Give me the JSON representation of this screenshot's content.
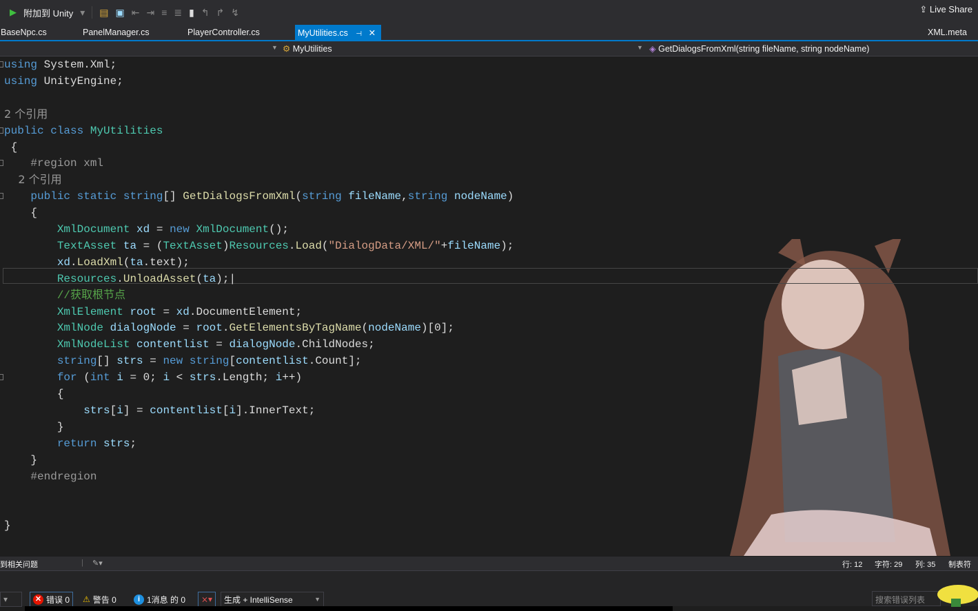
{
  "toolbar": {
    "attach_label": "附加到 Unity",
    "live_share": "Live Share"
  },
  "tabs": [
    {
      "label": "BaseNpc.cs"
    },
    {
      "label": "PanelManager.cs"
    },
    {
      "label": "PlayerController.cs"
    },
    {
      "label": "MyUtilities.cs",
      "active": true
    },
    {
      "label": "XML.meta"
    }
  ],
  "nav": {
    "class_name": "MyUtilities",
    "member": "GetDialogsFromXml(string fileName, string nodeName)"
  },
  "code": [
    [
      [
        "using",
        "kw"
      ],
      [
        " System.Xml;",
        "tx"
      ]
    ],
    [
      [
        "using",
        "kw"
      ],
      [
        " UnityEngine;",
        "tx"
      ]
    ],
    [],
    [
      [
        "2 个引用",
        "rf"
      ]
    ],
    [
      [
        "public",
        "kw"
      ],
      [
        " ",
        "tx"
      ],
      [
        "class",
        "kw"
      ],
      [
        " ",
        "tx"
      ],
      [
        "MyUtilities",
        "ty"
      ]
    ],
    [
      [
        " {",
        "tx"
      ]
    ],
    [
      [
        "    #region xml",
        "pp"
      ]
    ],
    [
      [
        "    2 个引用",
        "rf"
      ]
    ],
    [
      [
        "    ",
        "tx"
      ],
      [
        "public",
        "kw"
      ],
      [
        " ",
        "tx"
      ],
      [
        "static",
        "kw"
      ],
      [
        " ",
        "tx"
      ],
      [
        "string",
        "kw"
      ],
      [
        "[] ",
        "tx"
      ],
      [
        "GetDialogsFromXml",
        "fn"
      ],
      [
        "(",
        "tx"
      ],
      [
        "string",
        "kw"
      ],
      [
        " ",
        "tx"
      ],
      [
        "fileName",
        "pa"
      ],
      [
        ",",
        "tx"
      ],
      [
        "string",
        "kw"
      ],
      [
        " ",
        "tx"
      ],
      [
        "nodeName",
        "pa"
      ],
      [
        ")",
        "tx"
      ]
    ],
    [
      [
        "    {",
        "tx"
      ]
    ],
    [
      [
        "        ",
        "tx"
      ],
      [
        "XmlDocument",
        "ty"
      ],
      [
        " ",
        "tx"
      ],
      [
        "xd",
        "pa"
      ],
      [
        " = ",
        "tx"
      ],
      [
        "new",
        "kw"
      ],
      [
        " ",
        "tx"
      ],
      [
        "XmlDocument",
        "ty"
      ],
      [
        "();",
        "tx"
      ]
    ],
    [
      [
        "        ",
        "tx"
      ],
      [
        "TextAsset",
        "ty"
      ],
      [
        " ",
        "tx"
      ],
      [
        "ta",
        "pa"
      ],
      [
        " = (",
        "tx"
      ],
      [
        "TextAsset",
        "ty"
      ],
      [
        ")",
        "tx"
      ],
      [
        "Resources",
        "ty"
      ],
      [
        ".",
        "tx"
      ],
      [
        "Load",
        "fn"
      ],
      [
        "(",
        "tx"
      ],
      [
        "\"DialogData/XML/\"",
        "st"
      ],
      [
        "+",
        "tx"
      ],
      [
        "fileName",
        "pa"
      ],
      [
        ");",
        "tx"
      ]
    ],
    [
      [
        "        ",
        "tx"
      ],
      [
        "xd",
        "pa"
      ],
      [
        ".",
        "tx"
      ],
      [
        "LoadXml",
        "fn"
      ],
      [
        "(",
        "tx"
      ],
      [
        "ta",
        "pa"
      ],
      [
        ".text);",
        "tx"
      ]
    ],
    [
      [
        "        ",
        "tx"
      ],
      [
        "Resources",
        "ty"
      ],
      [
        ".",
        "tx"
      ],
      [
        "UnloadAsset",
        "fn"
      ],
      [
        "(",
        "tx"
      ],
      [
        "ta",
        "pa"
      ],
      [
        ");|",
        "tx"
      ]
    ],
    [
      [
        "        //获取根节点",
        "cm"
      ]
    ],
    [
      [
        "        ",
        "tx"
      ],
      [
        "XmlElement",
        "ty"
      ],
      [
        " ",
        "tx"
      ],
      [
        "root",
        "pa"
      ],
      [
        " = ",
        "tx"
      ],
      [
        "xd",
        "pa"
      ],
      [
        ".DocumentElement;",
        "tx"
      ]
    ],
    [
      [
        "        ",
        "tx"
      ],
      [
        "XmlNode",
        "ty"
      ],
      [
        " ",
        "tx"
      ],
      [
        "dialogNode",
        "pa"
      ],
      [
        " = ",
        "tx"
      ],
      [
        "root",
        "pa"
      ],
      [
        ".",
        "tx"
      ],
      [
        "GetElementsByTagName",
        "fn"
      ],
      [
        "(",
        "tx"
      ],
      [
        "nodeName",
        "pa"
      ],
      [
        ")[0];",
        "tx"
      ]
    ],
    [
      [
        "        ",
        "tx"
      ],
      [
        "XmlNodeList",
        "ty"
      ],
      [
        " ",
        "tx"
      ],
      [
        "contentlist",
        "pa"
      ],
      [
        " = ",
        "tx"
      ],
      [
        "dialogNode",
        "pa"
      ],
      [
        ".ChildNodes;",
        "tx"
      ]
    ],
    [
      [
        "        ",
        "tx"
      ],
      [
        "string",
        "kw"
      ],
      [
        "[] ",
        "tx"
      ],
      [
        "strs",
        "pa"
      ],
      [
        " = ",
        "tx"
      ],
      [
        "new",
        "kw"
      ],
      [
        " ",
        "tx"
      ],
      [
        "string",
        "kw"
      ],
      [
        "[",
        "tx"
      ],
      [
        "contentlist",
        "pa"
      ],
      [
        ".Count];",
        "tx"
      ]
    ],
    [
      [
        "        ",
        "tx"
      ],
      [
        "for",
        "kw"
      ],
      [
        " (",
        "tx"
      ],
      [
        "int",
        "kw"
      ],
      [
        " ",
        "tx"
      ],
      [
        "i",
        "pa"
      ],
      [
        " = 0; ",
        "tx"
      ],
      [
        "i",
        "pa"
      ],
      [
        " < ",
        "tx"
      ],
      [
        "strs",
        "pa"
      ],
      [
        ".Length; ",
        "tx"
      ],
      [
        "i",
        "pa"
      ],
      [
        "++)",
        "tx"
      ]
    ],
    [
      [
        "        {",
        "tx"
      ]
    ],
    [
      [
        "            ",
        "tx"
      ],
      [
        "strs",
        "pa"
      ],
      [
        "[",
        "tx"
      ],
      [
        "i",
        "pa"
      ],
      [
        "] = ",
        "tx"
      ],
      [
        "contentlist",
        "pa"
      ],
      [
        "[",
        "tx"
      ],
      [
        "i",
        "pa"
      ],
      [
        "].InnerText;",
        "tx"
      ]
    ],
    [
      [
        "        }",
        "tx"
      ]
    ],
    [
      [
        "        ",
        "tx"
      ],
      [
        "return",
        "kw"
      ],
      [
        " ",
        "tx"
      ],
      [
        "strs",
        "pa"
      ],
      [
        ";",
        "tx"
      ]
    ],
    [
      [
        "    }",
        "tx"
      ]
    ],
    [
      [
        "    #endregion",
        "pp"
      ]
    ],
    [],
    [],
    [
      [
        "}",
        "tx"
      ]
    ]
  ],
  "status": {
    "issues": "到相关问题",
    "line": "行: 12",
    "char": "字符: 29",
    "col": "列: 35",
    "tabs": "制表符"
  },
  "error_list": {
    "errors": "错误 0",
    "warnings": "警告 0",
    "messages": "1消息 的 0",
    "scope": "生成 + IntelliSense",
    "search_placeholder": "搜索错误列表"
  }
}
